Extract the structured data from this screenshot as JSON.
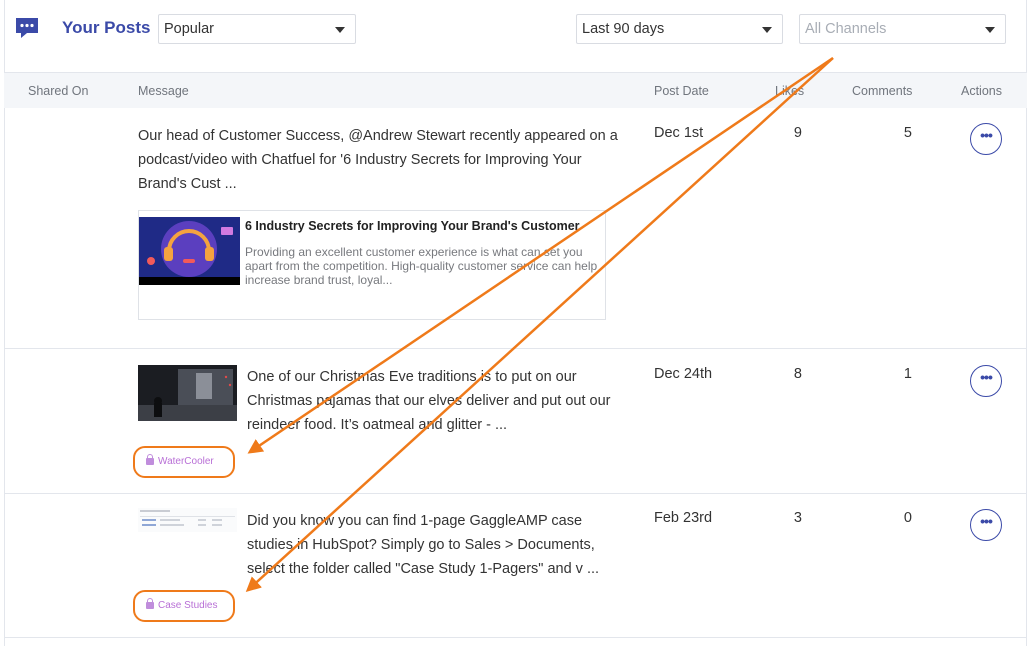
{
  "header": {
    "title": "Your Posts",
    "sort_select": "Popular",
    "range_select": "Last 90 days",
    "channels_select": "All Channels"
  },
  "table": {
    "columns": {
      "shared_on": "Shared On",
      "message": "Message",
      "post_date": "Post Date",
      "likes": "Likes",
      "comments": "Comments",
      "actions": "Actions"
    },
    "rows": [
      {
        "message": "Our head of Customer Success, @Andrew Stewart recently appeared on a podcast/video with Chatfuel for '6 Industry Secrets for Improving Your Brand's Cust ...",
        "card_title": "6 Industry Secrets for Improving Your Brand's Customer",
        "card_desc": "Providing an excellent customer experience is what can set you apart from the competition. High-quality customer service can help increase brand trust, loyal...",
        "post_date": "Dec 1st",
        "likes": "9",
        "comments": "5",
        "actions": "•••"
      },
      {
        "message": "One of our Christmas Eve traditions is to put on our Christmas pajamas that our elves deliver and put out our reindeer food. It’s oatmeal and glitter - ...",
        "channel": "WaterCooler",
        "post_date": "Dec 24th",
        "likes": "8",
        "comments": "1",
        "actions": "•••"
      },
      {
        "message": "Did you know you can find 1-page GaggleAMP case studies in HubSpot? Simply go to Sales > Documents, select the folder called \"Case Study 1-Pagers\" and v ...",
        "channel": "Case Studies",
        "post_date": "Feb 23rd",
        "likes": "3",
        "comments": "0",
        "actions": "•••"
      }
    ]
  },
  "colors": {
    "brand": "#3b4aa8",
    "annotation": "#ef7a1a",
    "channel_tag": "#b86fd6"
  },
  "icons": [
    "chat-bubble-icon",
    "chevron-down-icon",
    "lock-icon",
    "more-options-icon"
  ]
}
